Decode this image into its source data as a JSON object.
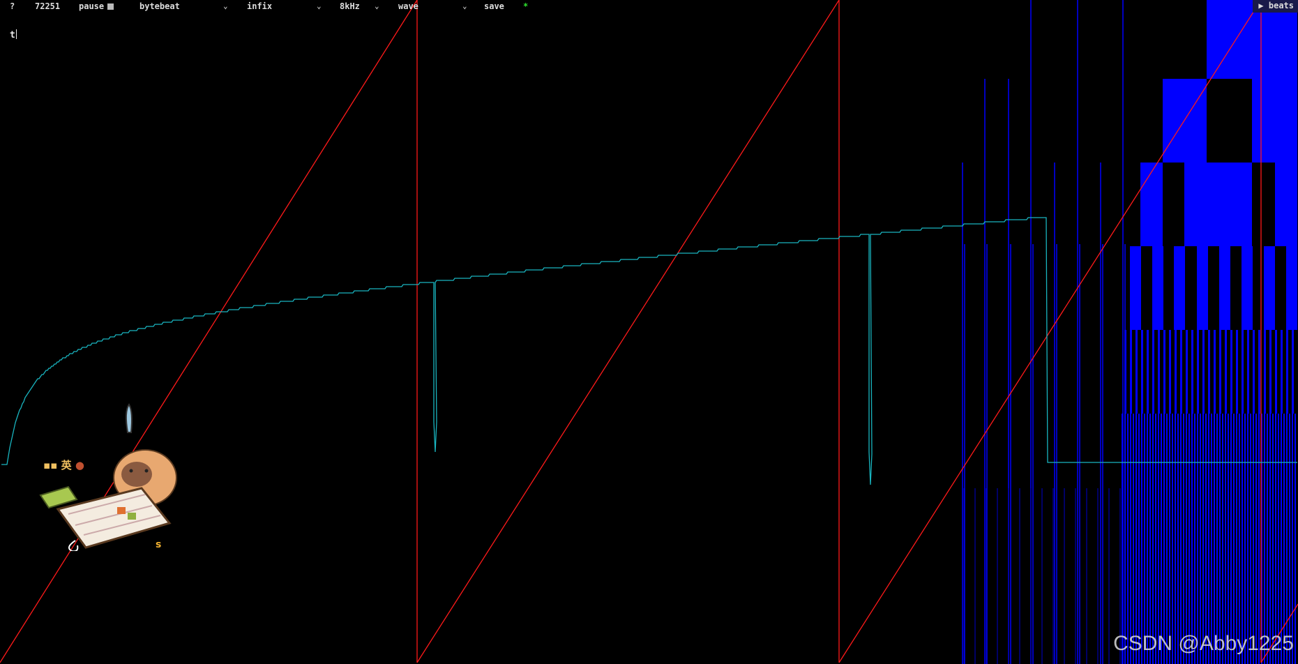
{
  "toolbar": {
    "help": "?",
    "counter": "72251",
    "pause_label": "pause",
    "mode_select": "bytebeat",
    "notation_select": "infix",
    "rate_select": "8kHz",
    "view_select": "wave",
    "save_label": "save",
    "star": "*",
    "beats_label": "▶ beats"
  },
  "editor": {
    "code": "t"
  },
  "sticker": {
    "ime_char": "英",
    "letter": "s"
  },
  "watermark": "CSDN @Abby1225",
  "colors": {
    "background": "#000000",
    "wave_red": "#ff1a1a",
    "wave_cyan": "#19b5c0",
    "bars_blue": "#0000ff",
    "star_green": "#2ee02e"
  }
}
